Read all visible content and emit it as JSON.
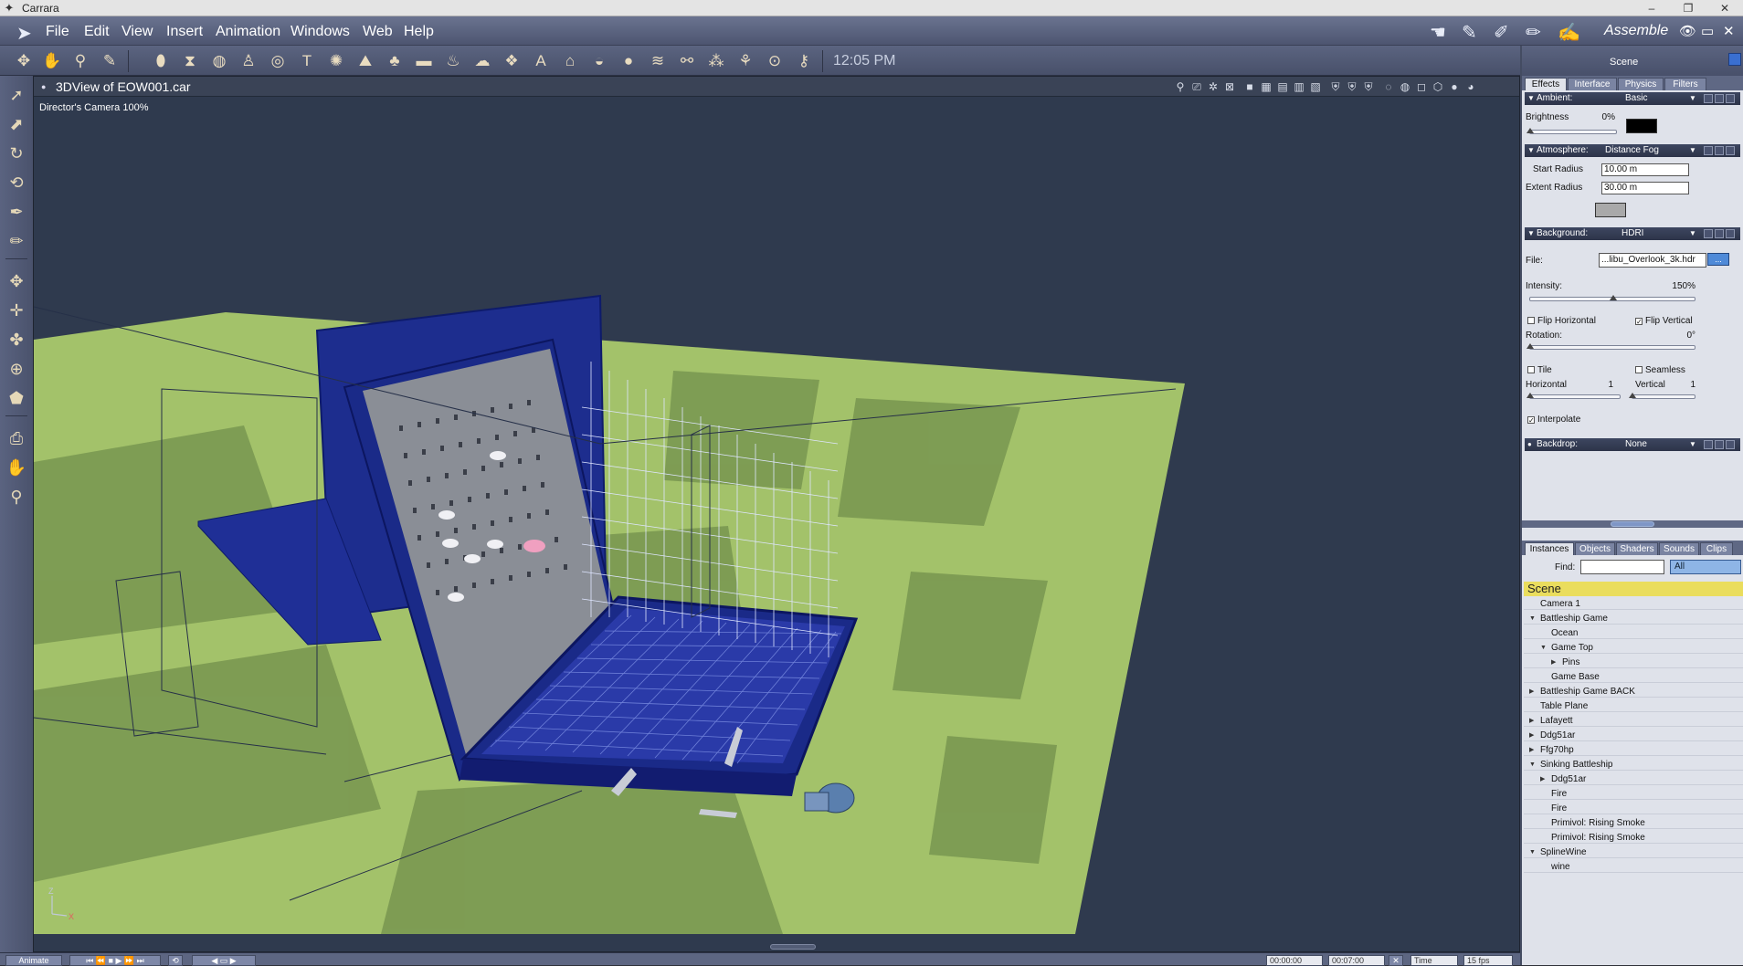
{
  "window": {
    "app_icon": "carrara-icon",
    "title": "Carrara",
    "minimize": "–",
    "restore": "❐",
    "close": "✕"
  },
  "menu": {
    "items": [
      "File",
      "Edit",
      "View",
      "Insert",
      "Animation",
      "Windows",
      "Web",
      "Help"
    ],
    "room": "Assemble",
    "room_icons": [
      "assemble-room-icon",
      "model-room-icon",
      "storyboard-room-icon",
      "texture-room-icon",
      "render-room-icon"
    ]
  },
  "toolbar": {
    "time": "12:05 PM",
    "icons": [
      "move-tool-icon",
      "hand-tool-icon",
      "zoom-tool-icon",
      "shaders-tool-icon",
      "cylinder-primitive-icon",
      "cone-primitive-icon",
      "sphere-primitive-icon",
      "figure-icon",
      "torus-primitive-icon",
      "text-object-icon",
      "spline-object-icon",
      "terrain-icon",
      "tree-icon",
      "plane-icon",
      "fire-icon",
      "cloud-icon",
      "replicator-icon",
      "agent-icon",
      "room-icon",
      "vertex-object-icon",
      "metaball-icon",
      "spring-icon",
      "bone-icon",
      "particles-icon",
      "anything-grows-icon",
      "light-bulb-icon",
      "spot-light-icon"
    ]
  },
  "left_tools": [
    "selection-arrow-icon",
    "direct-manipulation-icon",
    "rotate-tool-icon",
    "twist-tool-icon",
    "pen-tool-icon",
    "paint-tool-icon",
    "move-tool-icon",
    "plane-move-tool-icon",
    "trackball-tool-icon",
    "rotate-3d-tool-icon",
    "bounding-box-icon",
    "camera-tool-icon",
    "pan-hand-icon",
    "zoom-magnifier-icon"
  ],
  "viewport": {
    "title": "3DView of EOW001.car",
    "camera_label": "Director's Camera 100%",
    "header_icons": [
      "render-area-icon",
      "production-frame-icon",
      "light-icon",
      "camera-icon",
      "layout-1-icon",
      "layout-2-icon",
      "layout-3-icon",
      "layout-4-icon",
      "layout-5-icon",
      "shield-1-icon",
      "shield-2-icon",
      "shield-3-icon",
      "wire-sphere-icon",
      "dot-sphere-icon",
      "box-icon",
      "cube-icon",
      "shaded-sphere-icon",
      "textured-sphere-icon"
    ],
    "axis": {
      "z": "Z",
      "x": "X"
    }
  },
  "timeline": {
    "animate_label": "Animate",
    "time_start": "00:00:00",
    "time_end": "00:07:00",
    "time_mode": "Time",
    "fps": "15 fps"
  },
  "right_panel": {
    "title": "Scene",
    "top_tabs": [
      "Effects",
      "Interface",
      "Physics",
      "Filters"
    ],
    "ambient": {
      "label": "Ambient:",
      "value": "Basic",
      "brightness_label": "Brightness",
      "brightness_value": "0%",
      "brightness_level": 0,
      "color": "#000000"
    },
    "atmosphere": {
      "label": "Atmosphere:",
      "value": "Distance Fog",
      "start_radius_label": "Start Radius",
      "start_radius": "10.00 m",
      "extent_radius_label": "Extent Radius",
      "extent_radius": "30.00 m",
      "color": "#a9a9a9"
    },
    "background": {
      "label": "Background:",
      "value": "HDRI",
      "file_label": "File:",
      "file_value": "...libu_Overlook_3k.hdr",
      "file_button": "...",
      "intensity_label": "Intensity:",
      "intensity_value": "150%",
      "intensity_level": 0.5,
      "flip_horizontal": "Flip Horizontal",
      "flip_horizontal_checked": false,
      "flip_vertical": "Flip Vertical",
      "flip_vertical_checked": true,
      "rotation_label": "Rotation:",
      "rotation_value": "0°",
      "tile": "Tile",
      "tile_checked": false,
      "seamless": "Seamless",
      "seamless_checked": false,
      "horizontal_label": "Horizontal",
      "horizontal_value": "1",
      "vertical_label": "Vertical",
      "vertical_value": "1",
      "interpolate": "Interpolate",
      "interpolate_checked": true
    },
    "backdrop": {
      "label": "Backdrop:",
      "value": "None"
    },
    "bottom_tabs": [
      "Instances",
      "Objects",
      "Shaders",
      "Sounds",
      "Clips"
    ],
    "find_label": "Find:",
    "find_value": "",
    "filter_value": "All",
    "scene_root": "Scene",
    "tree": [
      {
        "label": "Camera 1",
        "depth": 0,
        "expander": ""
      },
      {
        "label": "Battleship Game",
        "depth": 0,
        "expander": "▼"
      },
      {
        "label": "Ocean",
        "depth": 1,
        "expander": ""
      },
      {
        "label": "Game Top",
        "depth": 1,
        "expander": "▼"
      },
      {
        "label": "Pins",
        "depth": 2,
        "expander": "▶"
      },
      {
        "label": "Game Base",
        "depth": 1,
        "expander": ""
      },
      {
        "label": "Battleship Game BACK",
        "depth": 0,
        "expander": "▶"
      },
      {
        "label": "Table Plane",
        "depth": 0,
        "expander": ""
      },
      {
        "label": "Lafayett",
        "depth": 0,
        "expander": "▶"
      },
      {
        "label": "Ddg51ar",
        "depth": 0,
        "expander": "▶"
      },
      {
        "label": "Ffg70hp",
        "depth": 0,
        "expander": "▶"
      },
      {
        "label": "Sinking Battleship",
        "depth": 0,
        "expander": "▼"
      },
      {
        "label": "Ddg51ar",
        "depth": 1,
        "expander": "▶"
      },
      {
        "label": "Fire",
        "depth": 1,
        "expander": ""
      },
      {
        "label": "Fire",
        "depth": 1,
        "expander": ""
      },
      {
        "label": "Primivol: Rising Smoke",
        "depth": 1,
        "expander": ""
      },
      {
        "label": "Primivol: Rising Smoke",
        "depth": 1,
        "expander": ""
      },
      {
        "label": "SplineWine",
        "depth": 0,
        "expander": "▼"
      },
      {
        "label": "wine",
        "depth": 1,
        "expander": ""
      }
    ]
  },
  "colors": {
    "ground": "#a3c26a",
    "ground_shadow": "#6f8a47",
    "game_blue": "#1d2d8e",
    "viewport_bg": "#2f3a4e",
    "scene_highlight": "#eadd5d"
  }
}
